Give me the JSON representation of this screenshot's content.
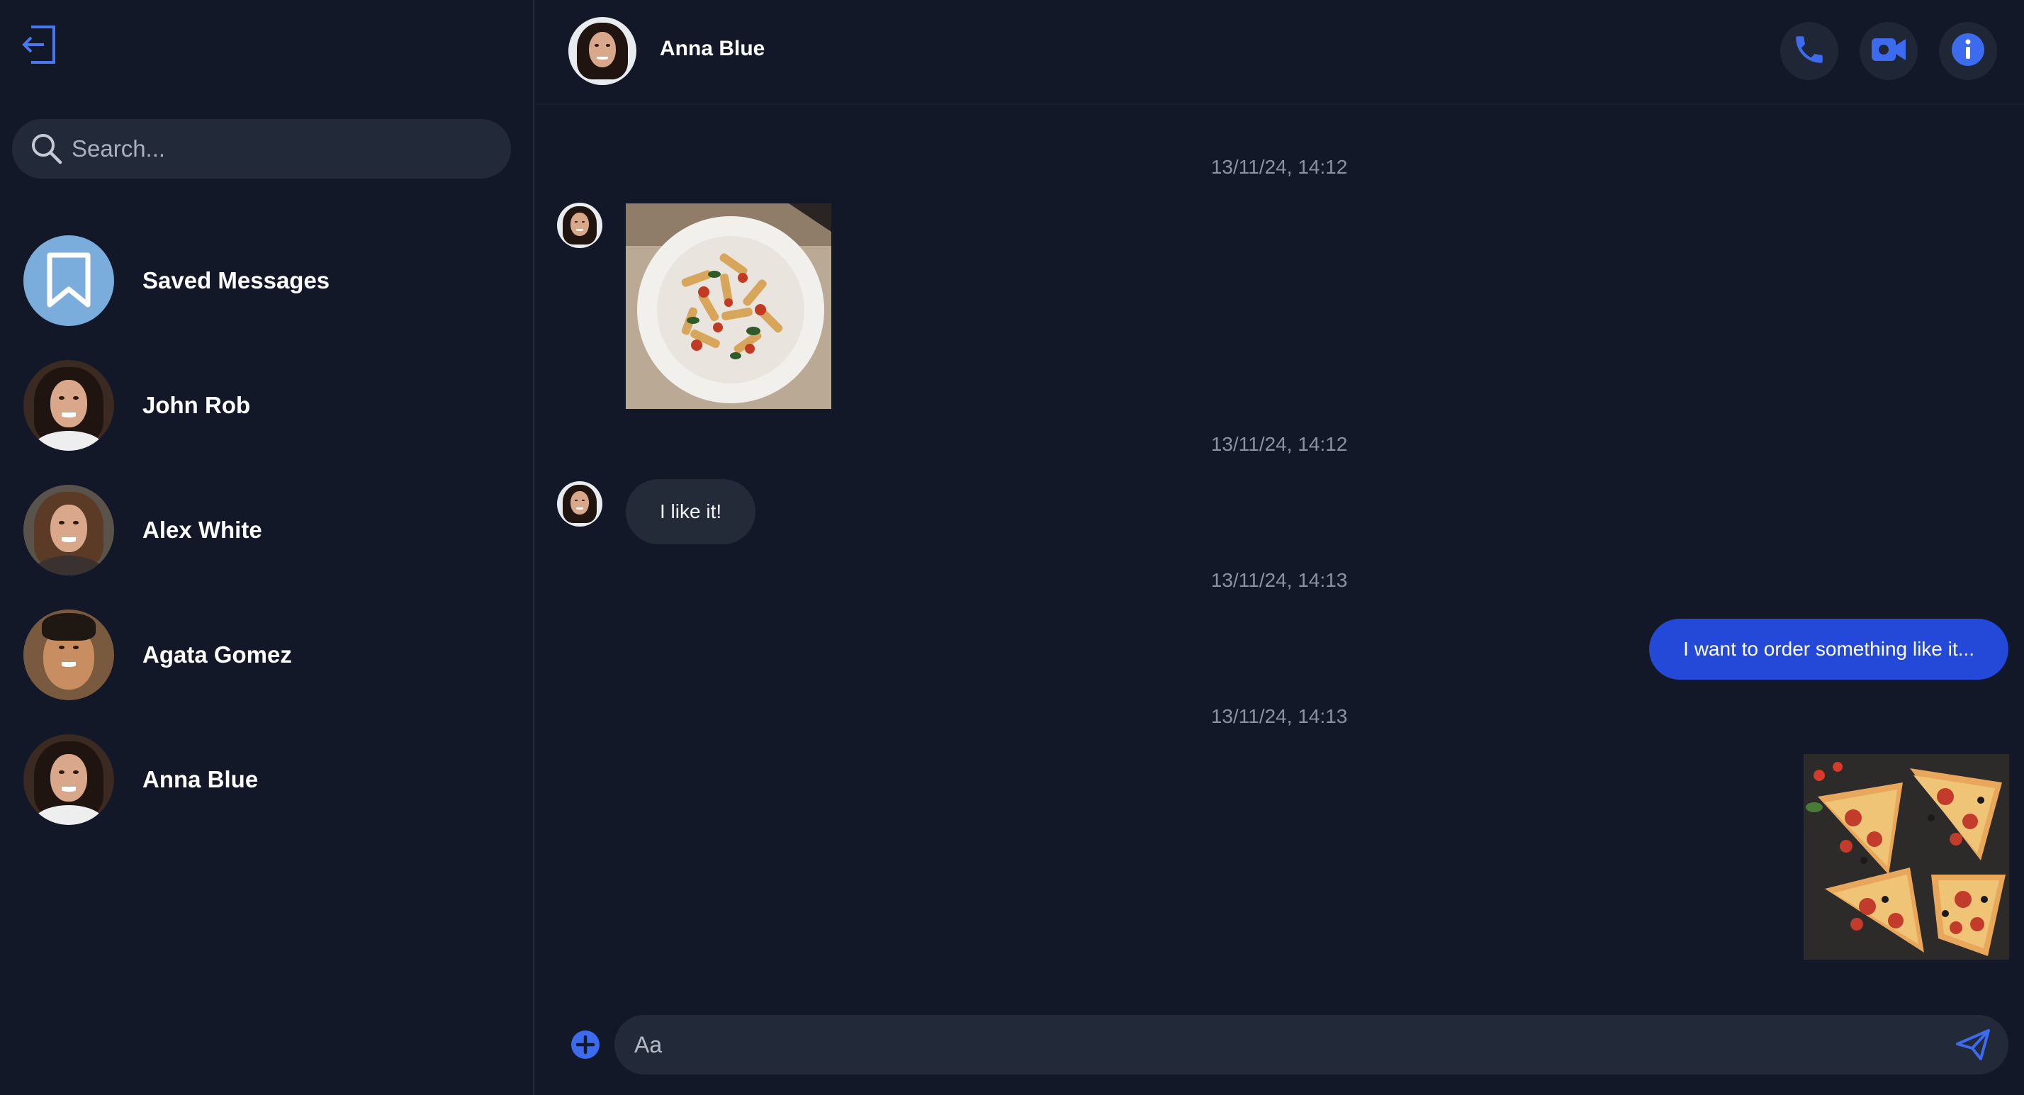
{
  "sidebar": {
    "search": {
      "placeholder": "Search..."
    },
    "chats": [
      {
        "name": "Saved Messages",
        "avatar": "bookmark-icon"
      },
      {
        "name": "John Rob",
        "avatar": "photo"
      },
      {
        "name": "Alex White",
        "avatar": "photo"
      },
      {
        "name": "Agata Gomez",
        "avatar": "photo"
      },
      {
        "name": "Anna Blue",
        "avatar": "photo"
      }
    ]
  },
  "header": {
    "name": "Anna Blue",
    "actions": [
      "phone-icon",
      "video-camera-icon",
      "info-icon"
    ]
  },
  "messages": [
    {
      "timestamp": "13/11/24, 14:12",
      "direction": "incoming",
      "type": "image",
      "content": "pasta-photo"
    },
    {
      "timestamp": "13/11/24, 14:12",
      "direction": "incoming",
      "type": "text",
      "text": "I like it!"
    },
    {
      "timestamp": "13/11/24, 14:13",
      "direction": "outgoing",
      "type": "text",
      "text": "I want to order something like it..."
    },
    {
      "timestamp": "13/11/24, 14:13",
      "direction": "outgoing",
      "type": "image",
      "content": "pizza-photo"
    }
  ],
  "composer": {
    "placeholder": "Aa"
  },
  "colors": {
    "background": "#121828",
    "accent": "#3d6bf0",
    "outgoing_bubble": "#2448d8",
    "incoming_bubble": "#232a38",
    "saved_avatar": "#7aaddc"
  }
}
